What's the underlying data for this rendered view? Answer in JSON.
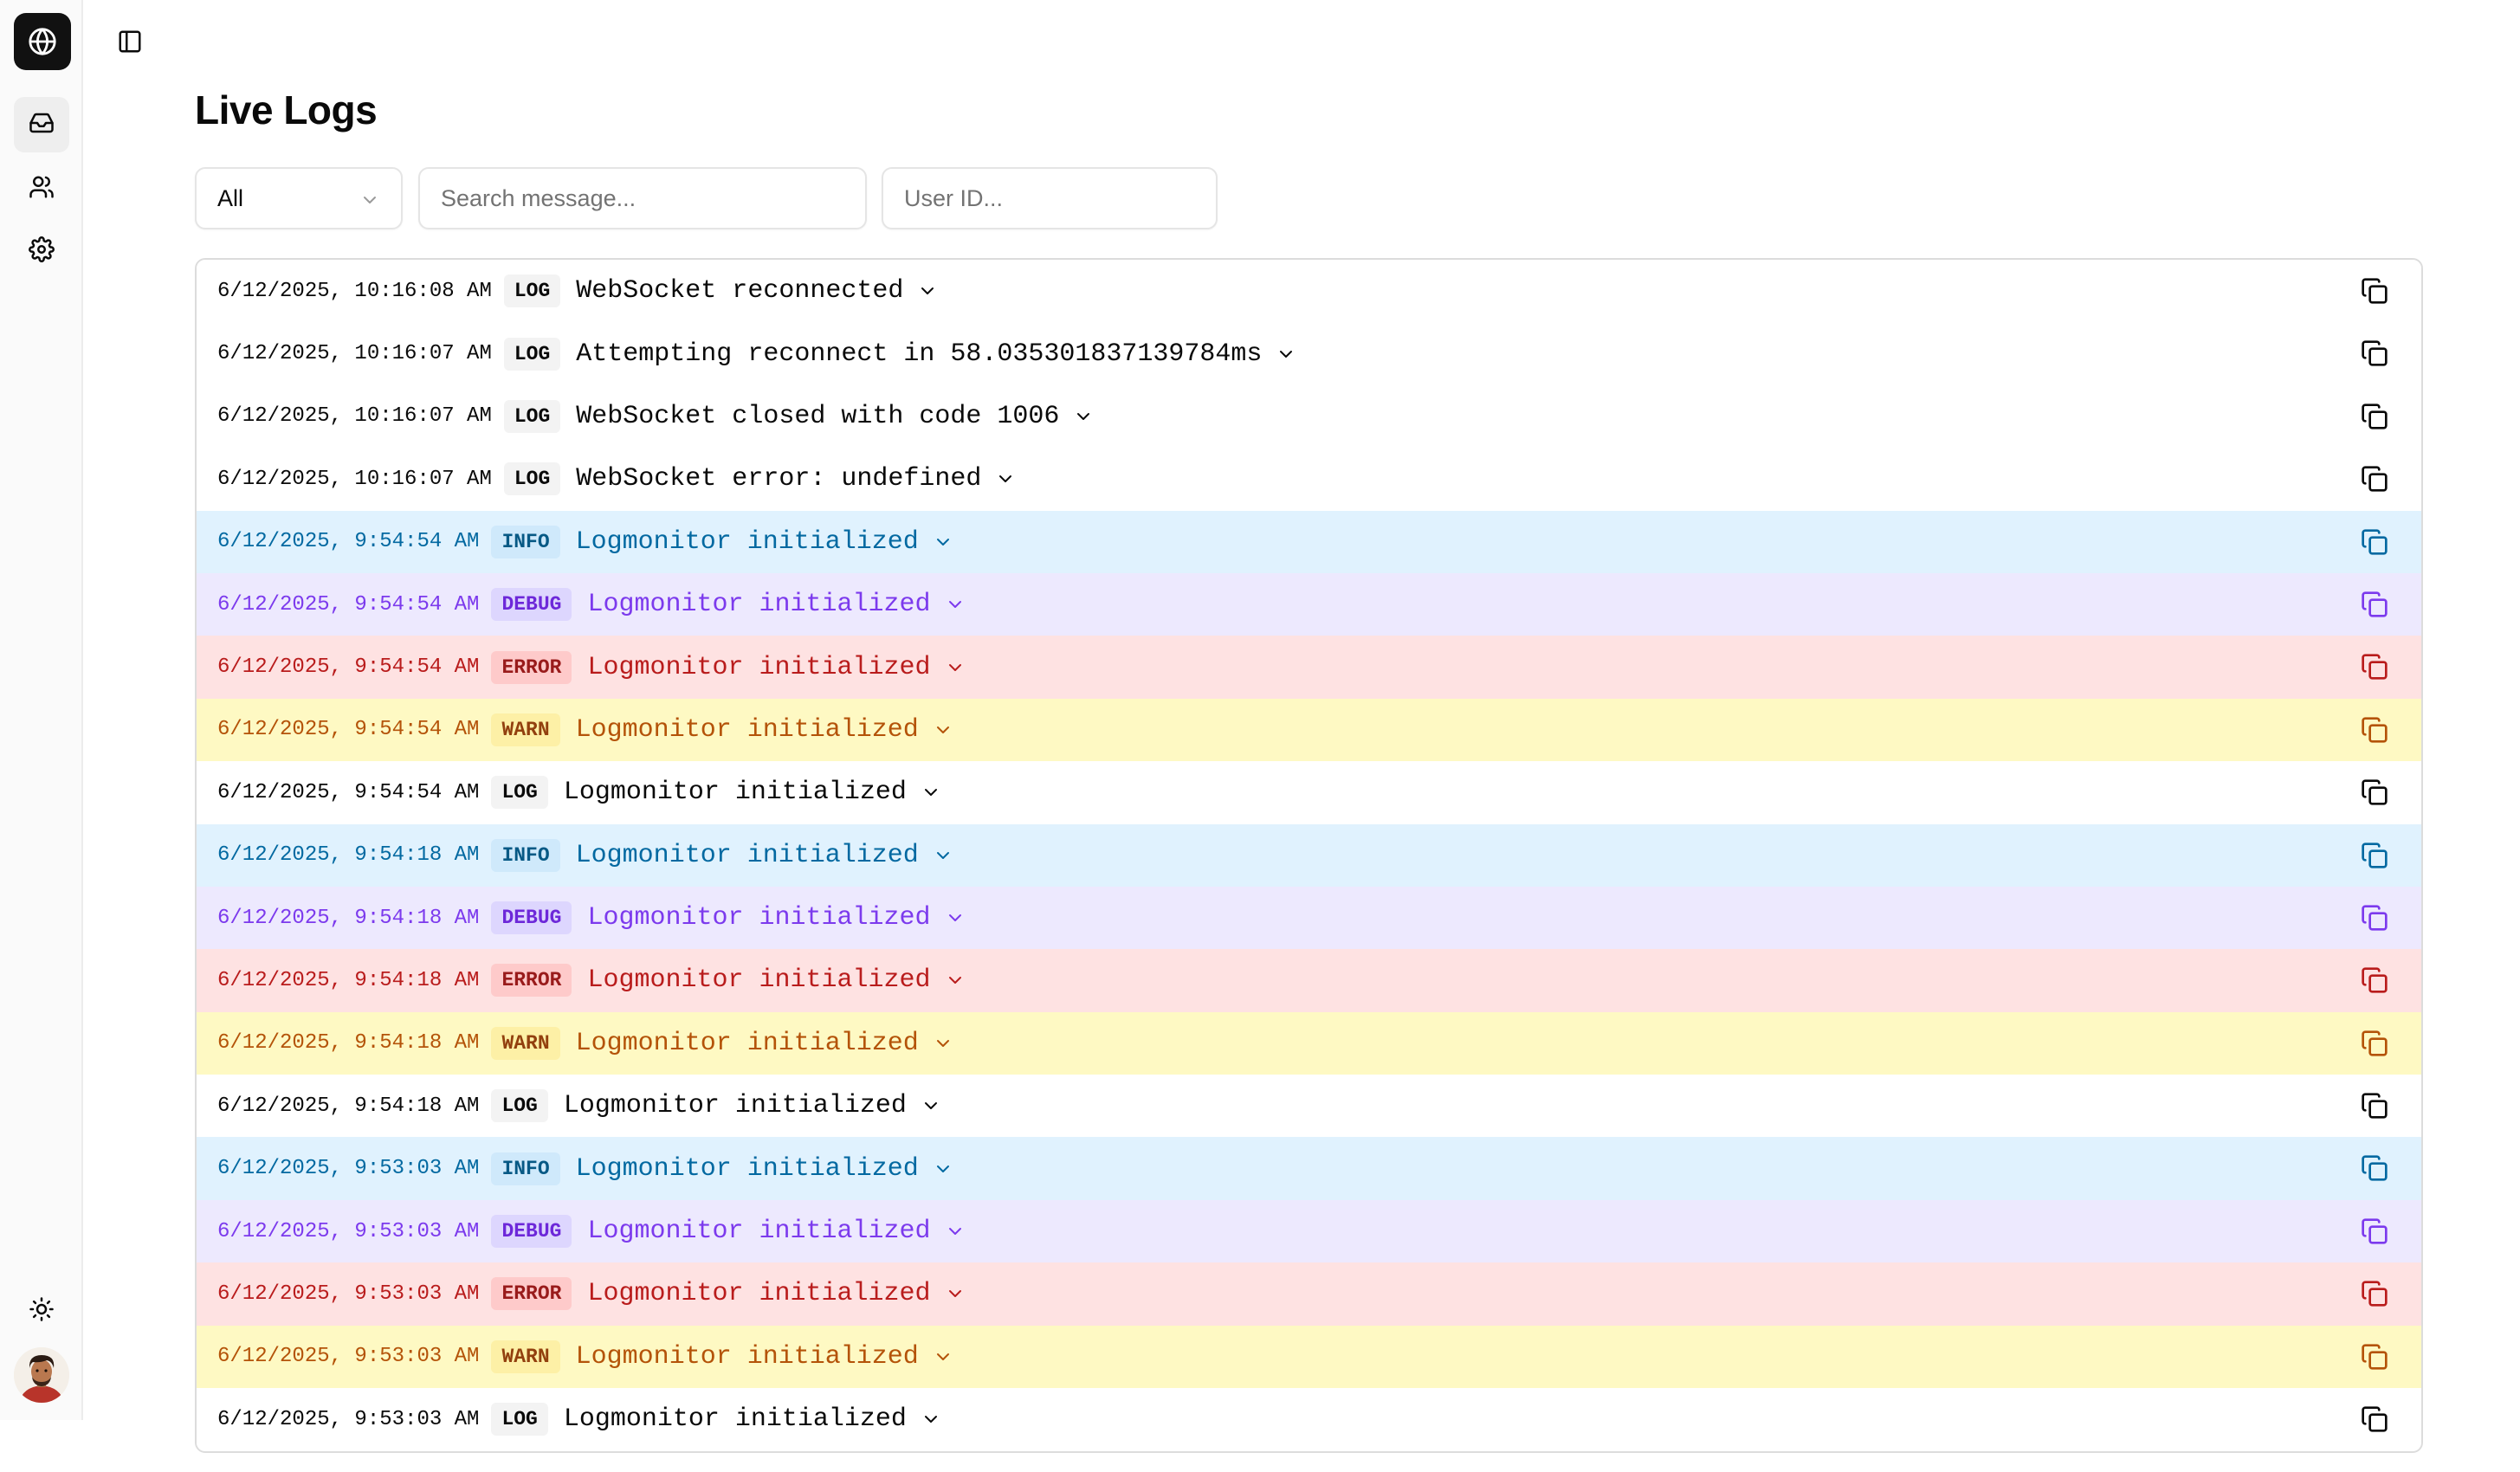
{
  "sidebar": {
    "logo_icon": "globe-icon",
    "nav": [
      {
        "icon": "inbox-icon",
        "active": true
      },
      {
        "icon": "users-icon",
        "active": false
      },
      {
        "icon": "settings-gear-icon",
        "active": false
      }
    ],
    "theme_icon": "sun-icon",
    "avatar_icon": "user-avatar"
  },
  "header": {
    "toggle_icon": "sidebar-toggle-icon",
    "title": "Live Logs"
  },
  "filters": {
    "level_value": "All",
    "search_placeholder": "Search message...",
    "user_placeholder": "User ID..."
  },
  "colors": {
    "log": "#0a0a0a",
    "info": "#0369a1",
    "debug": "#7c3aed",
    "error": "#b91c1c",
    "warn": "#b45309"
  },
  "logs": [
    {
      "timestamp": "6/12/2025, 10:16:08 AM",
      "level": "LOG",
      "message": "WebSocket reconnected"
    },
    {
      "timestamp": "6/12/2025, 10:16:07 AM",
      "level": "LOG",
      "message": "Attempting reconnect in 58.035301837139784ms"
    },
    {
      "timestamp": "6/12/2025, 10:16:07 AM",
      "level": "LOG",
      "message": "WebSocket closed with code 1006"
    },
    {
      "timestamp": "6/12/2025, 10:16:07 AM",
      "level": "LOG",
      "message": "WebSocket error: undefined"
    },
    {
      "timestamp": "6/12/2025, 9:54:54 AM",
      "level": "INFO",
      "message": "Logmonitor initialized"
    },
    {
      "timestamp": "6/12/2025, 9:54:54 AM",
      "level": "DEBUG",
      "message": "Logmonitor initialized"
    },
    {
      "timestamp": "6/12/2025, 9:54:54 AM",
      "level": "ERROR",
      "message": "Logmonitor initialized"
    },
    {
      "timestamp": "6/12/2025, 9:54:54 AM",
      "level": "WARN",
      "message": "Logmonitor initialized"
    },
    {
      "timestamp": "6/12/2025, 9:54:54 AM",
      "level": "LOG",
      "message": "Logmonitor initialized"
    },
    {
      "timestamp": "6/12/2025, 9:54:18 AM",
      "level": "INFO",
      "message": "Logmonitor initialized"
    },
    {
      "timestamp": "6/12/2025, 9:54:18 AM",
      "level": "DEBUG",
      "message": "Logmonitor initialized"
    },
    {
      "timestamp": "6/12/2025, 9:54:18 AM",
      "level": "ERROR",
      "message": "Logmonitor initialized"
    },
    {
      "timestamp": "6/12/2025, 9:54:18 AM",
      "level": "WARN",
      "message": "Logmonitor initialized"
    },
    {
      "timestamp": "6/12/2025, 9:54:18 AM",
      "level": "LOG",
      "message": "Logmonitor initialized"
    },
    {
      "timestamp": "6/12/2025, 9:53:03 AM",
      "level": "INFO",
      "message": "Logmonitor initialized"
    },
    {
      "timestamp": "6/12/2025, 9:53:03 AM",
      "level": "DEBUG",
      "message": "Logmonitor initialized"
    },
    {
      "timestamp": "6/12/2025, 9:53:03 AM",
      "level": "ERROR",
      "message": "Logmonitor initialized"
    },
    {
      "timestamp": "6/12/2025, 9:53:03 AM",
      "level": "WARN",
      "message": "Logmonitor initialized"
    },
    {
      "timestamp": "6/12/2025, 9:53:03 AM",
      "level": "LOG",
      "message": "Logmonitor initialized"
    }
  ]
}
